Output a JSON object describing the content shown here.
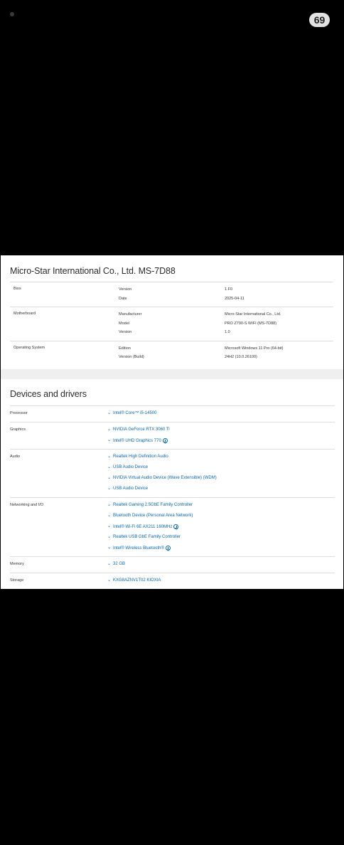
{
  "status": {
    "badge": "69"
  },
  "system": {
    "title": "Micro-Star International Co., Ltd. MS-7D88",
    "groups": [
      {
        "name": "Bios",
        "rows": [
          {
            "k": "Version",
            "v": "1.F0"
          },
          {
            "k": "Date",
            "v": "2025-04-11"
          }
        ]
      },
      {
        "name": "Motherboard",
        "rows": [
          {
            "k": "Manufacturer",
            "v": "Micro-Star International Co., Ltd."
          },
          {
            "k": "Model",
            "v": "PRO Z790-S WIFI (MS-7D88)"
          },
          {
            "k": "Version",
            "v": "1.0"
          }
        ]
      },
      {
        "name": "Operating System",
        "rows": [
          {
            "k": "Edition",
            "v": "Microsoft Windows 11 Pro (64-bit)"
          },
          {
            "k": "Version (Build)",
            "v": "24H2 (10.0.26100)"
          }
        ]
      }
    ]
  },
  "devices": {
    "title": "Devices and drivers",
    "groups": [
      {
        "name": "Processor",
        "items": [
          {
            "label": "Intel® Core™ i5-14500"
          }
        ]
      },
      {
        "name": "Graphics",
        "items": [
          {
            "label": "NVIDIA GeForce RTX 3060 Ti"
          },
          {
            "label": "Intel® UHD Graphics 770",
            "download": true
          }
        ]
      },
      {
        "name": "Audio",
        "items": [
          {
            "label": "Realtek High Definition Audio"
          },
          {
            "label": "USB Audio Device"
          },
          {
            "label": "NVIDIA Virtual Audio Device (Wave Extensible) (WDM)"
          },
          {
            "label": "USB Audio Device"
          }
        ]
      },
      {
        "name": "Networking and I/O",
        "items": [
          {
            "label": "Realtek Gaming 2.5GbE Family Controller"
          },
          {
            "label": "Bluetooth Device (Personal Area Network)"
          },
          {
            "label": "Intel® Wi-Fi 6E AX211 160MHz",
            "download": true
          },
          {
            "label": "Realtek USB GbE Family Controller"
          },
          {
            "label": "Intel® Wireless Bluetooth®",
            "download": true
          }
        ]
      },
      {
        "name": "Memory",
        "items": [
          {
            "label": "32 GB"
          }
        ]
      },
      {
        "name": "Storage",
        "items": [
          {
            "label": "KXG8AZNV1T02 KIOXIA"
          }
        ]
      }
    ]
  },
  "colors": {
    "link": "#0068b5",
    "divider": "#dddddd"
  }
}
